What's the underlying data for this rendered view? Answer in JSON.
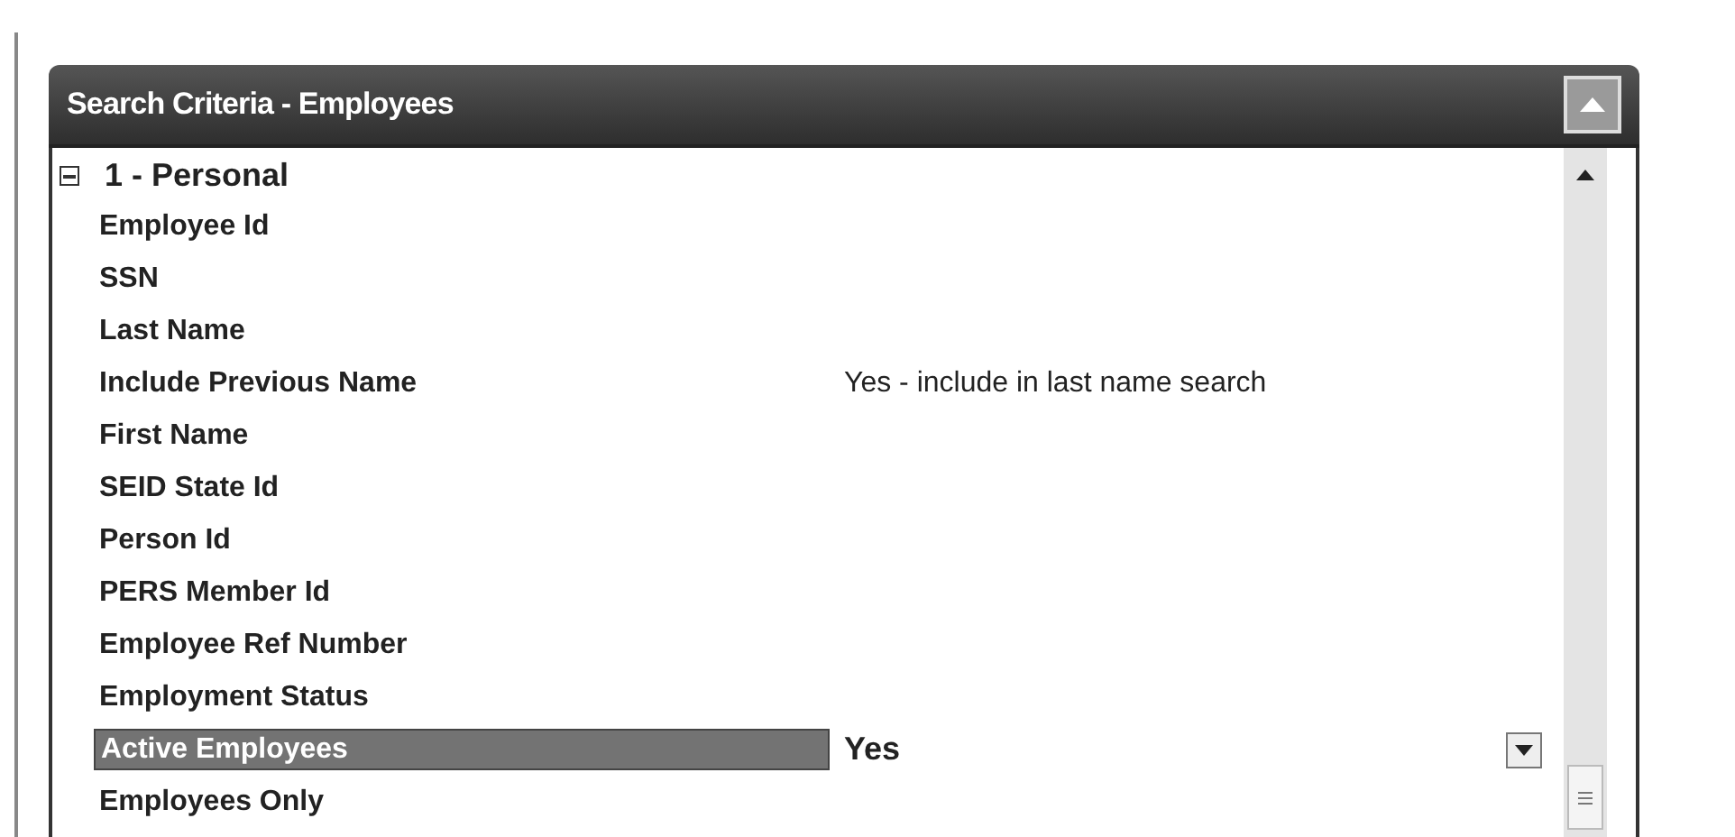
{
  "panel": {
    "title": "Search Criteria - Employees"
  },
  "section": {
    "label": "1 - Personal",
    "expanded": true,
    "rows": [
      {
        "label": "Employee Id",
        "selected": false
      },
      {
        "label": "SSN",
        "selected": false
      },
      {
        "label": "Last Name",
        "selected": false
      },
      {
        "label": "Include Previous Name",
        "value": "Yes - include in last name search",
        "selected": false
      },
      {
        "label": "First Name",
        "selected": false
      },
      {
        "label": "SEID State Id",
        "selected": false
      },
      {
        "label": "Person Id",
        "selected": false
      },
      {
        "label": "PERS Member Id",
        "selected": false
      },
      {
        "label": "Employee Ref Number",
        "selected": false
      },
      {
        "label": "Employment Status",
        "selected": false
      },
      {
        "label": "Active Employees",
        "value": "Yes",
        "selected": true
      },
      {
        "label": "Employees Only",
        "selected": false
      }
    ]
  }
}
